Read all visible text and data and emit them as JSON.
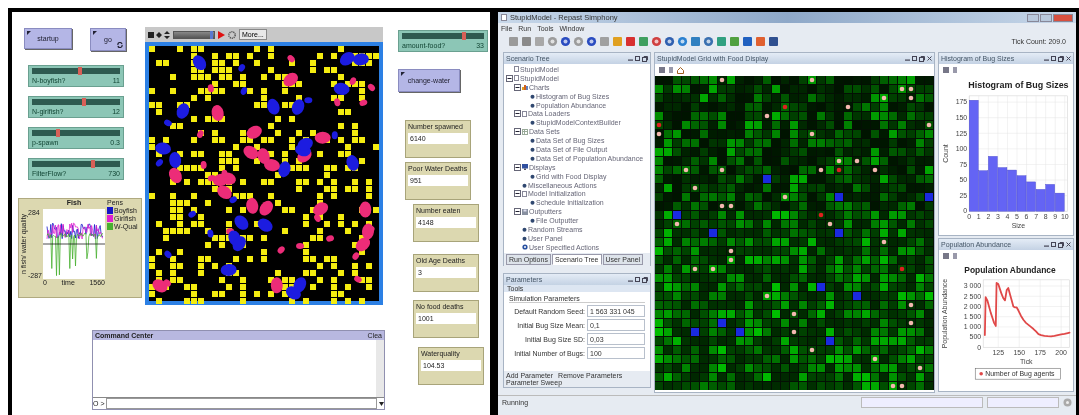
{
  "netlogo": {
    "buttons": [
      {
        "label": "startup",
        "kind": "once"
      },
      {
        "label": "go",
        "kind": "forever"
      }
    ],
    "sliders": [
      {
        "label": "N-boyfish?",
        "value": "11",
        "level": 0.55
      },
      {
        "label": "N-girlfish?",
        "value": "12",
        "level": 0.59
      },
      {
        "label": "p-spawn",
        "value": "0.3",
        "level": 0.3
      },
      {
        "label": "FilterFlow?",
        "value": "730",
        "level": 0.69
      }
    ],
    "plot": {
      "title": "Fish",
      "pens_title": "Pens",
      "pens": [
        {
          "name": "Boyfish",
          "color": "#1414c8"
        },
        {
          "name": "Girlfish",
          "color": "#e020d0"
        },
        {
          "name": "W-Qual",
          "color": "#48b030"
        }
      ],
      "ylabel": "n fish/ water quality",
      "y_max": "284",
      "y_min": "-287",
      "x_min": "0",
      "xlabel": "time",
      "x_max": "1560"
    },
    "view": {
      "speed_slider": {
        "level": 0.9
      },
      "more_button": "More..."
    },
    "food_slider": {
      "label": "amount-food?",
      "value": "33",
      "level": 0.75
    },
    "water_button": {
      "label": "change-water",
      "kind": "once"
    },
    "monitors": [
      {
        "label": "Number spawned",
        "value": "6140"
      },
      {
        "label": "Poor Water Deaths",
        "value": "951"
      },
      {
        "label": "Number eaten",
        "value": "4148"
      },
      {
        "label": "Old Age Deaths",
        "value": "3"
      },
      {
        "label": "No food deaths",
        "value": "1001"
      },
      {
        "label": "Waterquality",
        "value": "104.53"
      }
    ],
    "command_center": {
      "title": "Command Center",
      "clear": "Clea",
      "prompt": "O >"
    }
  },
  "repast": {
    "window": {
      "title": "StupidModel - Repast Simphony"
    },
    "menu": [
      "File",
      "Run",
      "Tools",
      "Window"
    ],
    "tick_count": "Tick Count: 209.0",
    "scenario": {
      "title": "Scenario Tree",
      "tree": [
        {
          "label": "StupidModel",
          "kind": "model"
        },
        {
          "label": "StupidModel",
          "kind": "model",
          "expanded": true,
          "children": [
            {
              "label": "Charts",
              "kind": "charts",
              "expanded": true,
              "children": [
                {
                  "label": "Histogram of Bug Sizes",
                  "kind": "item"
                },
                {
                  "label": "Population Abundance",
                  "kind": "item"
                }
              ]
            },
            {
              "label": "Data Loaders",
              "kind": "model",
              "expanded": true,
              "children": [
                {
                  "label": "StupidModelContextBuilder",
                  "kind": "item"
                }
              ]
            },
            {
              "label": "Data Sets",
              "kind": "datasets",
              "expanded": true,
              "children": [
                {
                  "label": "Data Set of Bug Sizes",
                  "kind": "item"
                },
                {
                  "label": "Data Set of File Output",
                  "kind": "item"
                },
                {
                  "label": "Data Set of Population Abundance",
                  "kind": "item"
                }
              ]
            },
            {
              "label": "Displays",
              "kind": "displays",
              "expanded": true,
              "children": [
                {
                  "label": "Grid with Food Display",
                  "kind": "item"
                }
              ]
            },
            {
              "label": "Miscellaneous Actions",
              "kind": "item"
            },
            {
              "label": "Model Initialization",
              "kind": "model",
              "expanded": true,
              "children": [
                {
                  "label": "Schedule Initialization",
                  "kind": "item"
                }
              ]
            },
            {
              "label": "Outputters",
              "kind": "outputters",
              "expanded": true,
              "children": [
                {
                  "label": "File Outputter",
                  "kind": "item"
                }
              ]
            },
            {
              "label": "Random Streams",
              "kind": "item"
            },
            {
              "label": "User Panel",
              "kind": "item"
            },
            {
              "label": "User Specified Actions",
              "kind": "actions"
            }
          ]
        }
      ],
      "tabs": [
        {
          "label": "Run Options",
          "selected": false
        },
        {
          "label": "Scenario Tree",
          "selected": true
        },
        {
          "label": "User Panel",
          "selected": false
        }
      ]
    },
    "parameters": {
      "title": "Parameters",
      "menu": "Tools",
      "group": "Simulation Parameters",
      "fields": [
        {
          "label": "Default Random Seed:",
          "value": "1 563 331 045"
        },
        {
          "label": "Initial Bug Size Mean:",
          "value": "0,1"
        },
        {
          "label": "Initial Bug Size SD:",
          "value": "0,03"
        },
        {
          "label": "Initial Number of Bugs:",
          "value": "100"
        }
      ],
      "actions": [
        "Add Parameter",
        "Remove Parameters",
        "Parameter Sweep"
      ]
    },
    "grid": {
      "title": "StupidModel Grid with Food Display"
    },
    "histogram": {
      "panel_title": "Histogram of Bug Sizes",
      "chart_data": {
        "type": "bar",
        "title": "Histogram of Bug Sizes",
        "xlabel": "Size",
        "ylabel": "Count",
        "x": [
          0.5,
          1.5,
          2.5,
          3.5,
          4.5,
          5.5,
          6.5,
          7.5,
          8.5,
          9.5
        ],
        "values": [
          178,
          65,
          88,
          70,
          66,
          57,
          47,
          35,
          43,
          29
        ],
        "grid": true,
        "xlim": [
          0,
          10.3
        ],
        "ylim": [
          0,
          185
        ],
        "xticks": [
          0,
          1,
          2,
          3,
          4,
          5,
          6,
          7,
          8,
          9,
          10
        ],
        "yticks": [
          0,
          25,
          50,
          75,
          100,
          125,
          150,
          175
        ]
      }
    },
    "population": {
      "panel_title": "Population Abundance",
      "chart_data": {
        "type": "line",
        "title": "Population Abundance",
        "xlabel": "Tick",
        "ylabel": "Population Abundance",
        "x": [
          109,
          110,
          112,
          114,
          116,
          118,
          120,
          122,
          123,
          125,
          127,
          129,
          131,
          133,
          135,
          137,
          139,
          141,
          143,
          145,
          147,
          149,
          152,
          155,
          158,
          161,
          164,
          167,
          170,
          173,
          176,
          180,
          184,
          188,
          192,
          196,
          200,
          204,
          208,
          210
        ],
        "series": [
          {
            "name": "Number of Bug agents",
            "color": "#e04848",
            "values": [
              600,
              2450,
              2300,
              2000,
              1700,
              1450,
              1200,
              1050,
              3150,
              3100,
              2850,
              2600,
              2400,
              2300,
              2800,
              2900,
              2600,
              2300,
              2000,
              1950,
              1950,
              1800,
              1550,
              1350,
              1200,
              1100,
              1000,
              900,
              780,
              650,
              600,
              570,
              550,
              540,
              560,
              600,
              630,
              660,
              700,
              720
            ]
          }
        ],
        "grid": true,
        "xlim": [
          107,
          210
        ],
        "ylim": [
          0,
          3300
        ],
        "xticks": [
          125,
          150,
          175,
          200
        ],
        "yticks": [
          {
            "value": 0,
            "label": "0"
          },
          {
            "value": 500,
            "label": "500"
          },
          {
            "value": 1000,
            "label": "1 000"
          },
          {
            "value": 1500,
            "label": "1 500"
          },
          {
            "value": 2000,
            "label": "2 000"
          },
          {
            "value": 2500,
            "label": "2 500"
          },
          {
            "value": 3000,
            "label": "3 000"
          }
        ]
      }
    },
    "status": "Running"
  }
}
